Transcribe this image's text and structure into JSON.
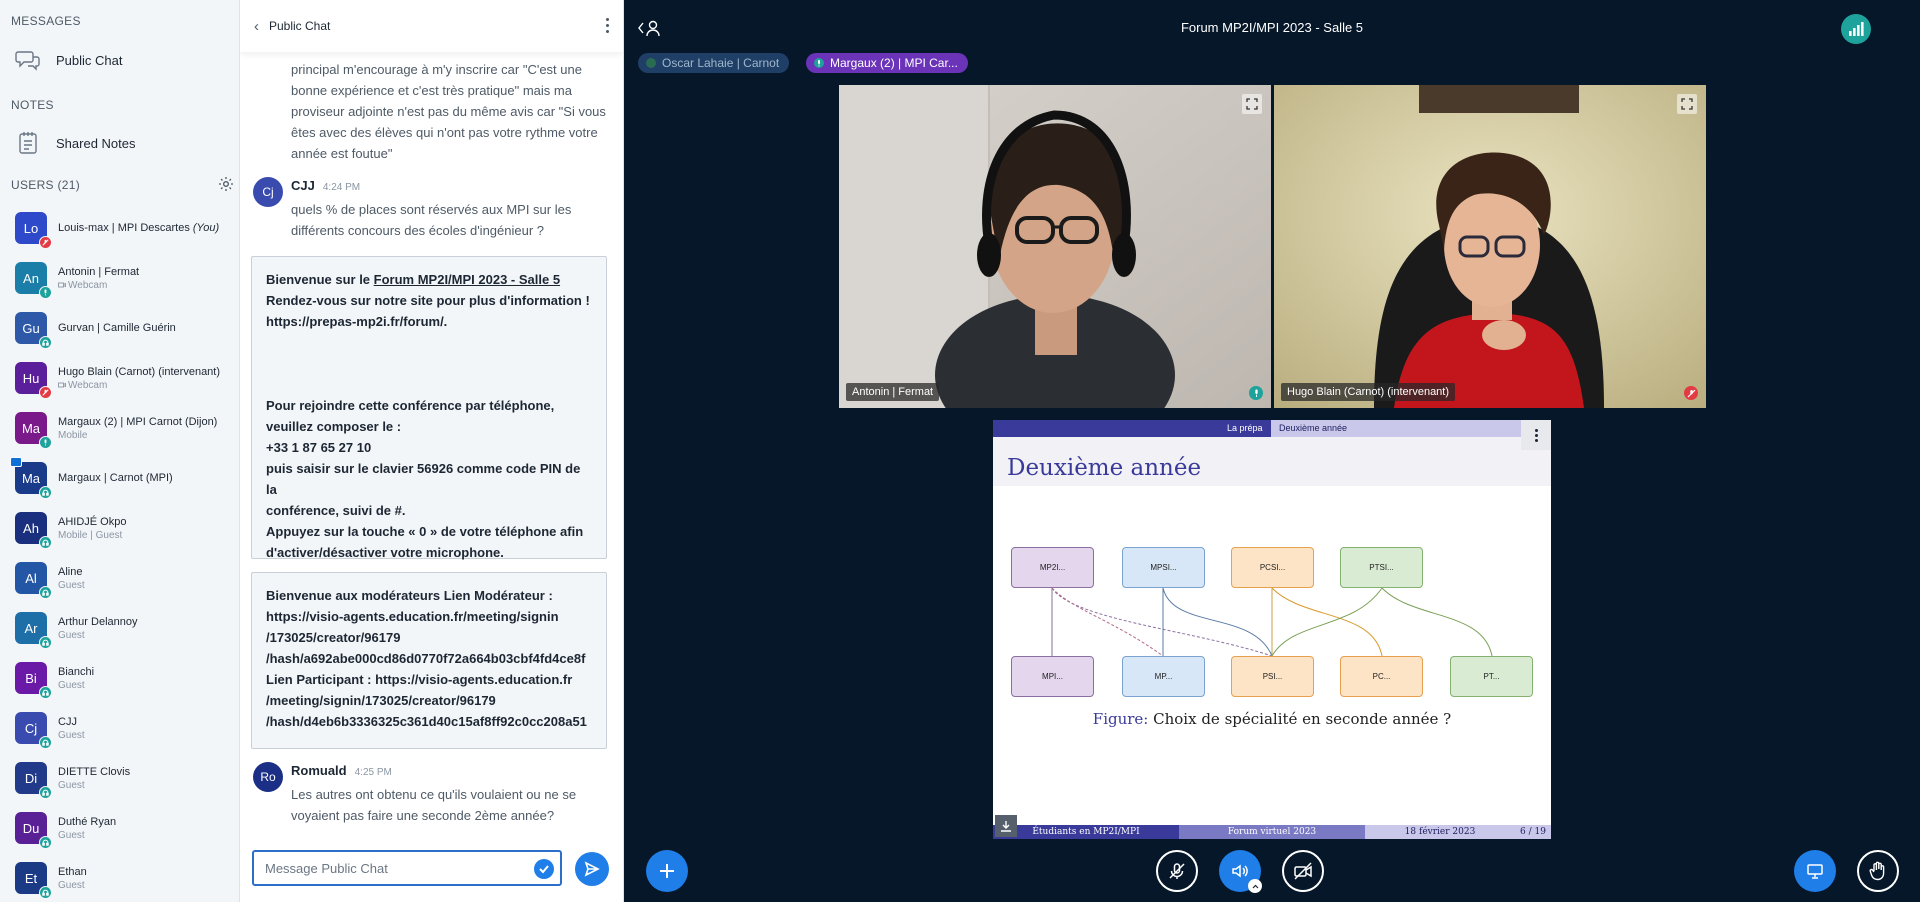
{
  "sections": {
    "messages": "MESSAGES",
    "notes": "NOTES",
    "users": "USERS (21)"
  },
  "nav": {
    "public_chat": "Public Chat",
    "shared_notes": "Shared Notes"
  },
  "users": [
    {
      "initials": "Lo",
      "name": "Louis-max | MPI Descartes",
      "you": "(You)",
      "sub": "",
      "color": "#2e49c9",
      "badge": "muted"
    },
    {
      "initials": "An",
      "name": "Antonin | Fermat",
      "sub": "Webcam",
      "color": "#1a7ea8",
      "badge": "mic"
    },
    {
      "initials": "Gu",
      "name": "Gurvan | Camille Guérin",
      "sub": "",
      "color": "#2e58a8",
      "badge": "listen"
    },
    {
      "initials": "Hu",
      "name": "Hugo Blain (Carnot) (intervenant)",
      "sub": "Webcam",
      "color": "#5b1f9c",
      "badge": "muted"
    },
    {
      "initials": "Ma",
      "name": "Margaux (2) | MPI Carnot (Dijon)",
      "sub": "Mobile",
      "color": "#7a1a8a",
      "badge": "mic"
    },
    {
      "initials": "Ma",
      "name": "Margaux | Carnot (MPI)",
      "sub": "",
      "color": "#1a3b8a",
      "badge": "listen",
      "presenter": true
    },
    {
      "initials": "Ah",
      "name": "AHIDJÉ Okpo",
      "sub": "Mobile | Guest",
      "color": "#1a2f7e",
      "badge": "listen"
    },
    {
      "initials": "Al",
      "name": "Aline",
      "sub": "Guest",
      "color": "#2357a6",
      "badge": "listen"
    },
    {
      "initials": "Ar",
      "name": "Arthur Delannoy",
      "sub": "Guest",
      "color": "#1e6fa8",
      "badge": "listen"
    },
    {
      "initials": "Bi",
      "name": "Bianchi",
      "sub": "Guest",
      "color": "#6a1aa6",
      "badge": "listen"
    },
    {
      "initials": "Cj",
      "name": "CJJ",
      "sub": "Guest",
      "color": "#3a4bb0",
      "badge": "listen"
    },
    {
      "initials": "Di",
      "name": "DIETTE Clovis",
      "sub": "Guest",
      "color": "#213a8a",
      "badge": "listen"
    },
    {
      "initials": "Du",
      "name": "Duthé Ryan",
      "sub": "Guest",
      "color": "#5a2096",
      "badge": "listen"
    },
    {
      "initials": "Et",
      "name": "Ethan",
      "sub": "Guest",
      "color": "#1b3a86",
      "badge": "listen"
    }
  ],
  "chat": {
    "title": "Public Chat",
    "partial_message": [
      "principal m'encourage à m'y inscrire car \"C'est une",
      "bonne expérience et c'est très pratique\" mais ma",
      "proviseur adjointe n'est pas du même avis car \"Si vous",
      "êtes avec des élèves qui n'ont pas votre rythme votre",
      "année est foutue\""
    ],
    "msg1": {
      "initials": "Cj",
      "author": "CJJ",
      "time": "4:24 PM",
      "lines": [
        "quels % de places sont réservés aux MPI sur les",
        "différents concours des écoles d'ingénieur ?"
      ]
    },
    "welcome": {
      "l1_prefix": "Bienvenue sur le ",
      "l1_link": "Forum MP2I/MPI 2023 - Salle 5",
      "l2": "Rendez-vous sur notre site pour plus d'information !",
      "l3": "https://prepas-mp2i.fr/forum/.",
      "l4": "Pour rejoindre cette conférence par téléphone,",
      "l5": "veuillez composer le :",
      "l6": "+33 1 87 65 27 10",
      "l7": "puis saisir sur le clavier 56926 comme code PIN de la",
      "l8": "conférence, suivi de #.",
      "l9": "Appuyez sur la touche « 0 » de votre téléphone afin",
      "l10": "d'activer/désactiver votre microphone."
    },
    "moderator": [
      "Bienvenue aux modérateurs Lien Modérateur :",
      "https://visio-agents.education.fr/meeting/signin",
      "/173025/creator/96179",
      "/hash/a692abe000cd86d0770f72a664b03cbf4fd4ce8f",
      "Lien Participant : https://visio-agents.education.fr",
      "/meeting/signin/173025/creator/96179",
      "/hash/d4eb6b3336325c361d40c15af8ff92c0cc208a51"
    ],
    "msg2": {
      "initials": "Ro",
      "author": "Romuald",
      "time": "4:25 PM",
      "lines": [
        "Les autres ont obtenu ce qu'ils voulaient ou ne se",
        "voyaient pas faire une seconde 2ème année?"
      ]
    },
    "input_placeholder": "Message Public Chat"
  },
  "main": {
    "title": "Forum MP2I/MPI 2023 - Salle 5",
    "talkers": [
      "Oscar Lahaie | Carnot",
      "Margaux (2) | MPI Car..."
    ],
    "video1_label": "Antonin | Fermat",
    "video2_label": "Hugo Blain (Carnot) (intervenant)"
  },
  "slide": {
    "nav_left": "La prépa",
    "nav_right": "Deuxième année",
    "title": "Deuxième année",
    "row1": [
      "MP2I...",
      "MPSI...",
      "PCSI...",
      "PTSI..."
    ],
    "row2": [
      "MPI...",
      "MP...",
      "PSI...",
      "PC...",
      "PT..."
    ],
    "caption_label": "Figure:",
    "caption": "Choix de spécialité en seconde année ?",
    "foot1": "Étudiants en MP2I/MPI",
    "foot2": "Forum virtuel 2023",
    "foot3": "18 février 2023",
    "foot4": "6 / 19"
  },
  "colors": {
    "accent": "#1f7ee8",
    "muted": "#e33b44",
    "listening": "#1da39b",
    "connection": "#1da39b"
  }
}
